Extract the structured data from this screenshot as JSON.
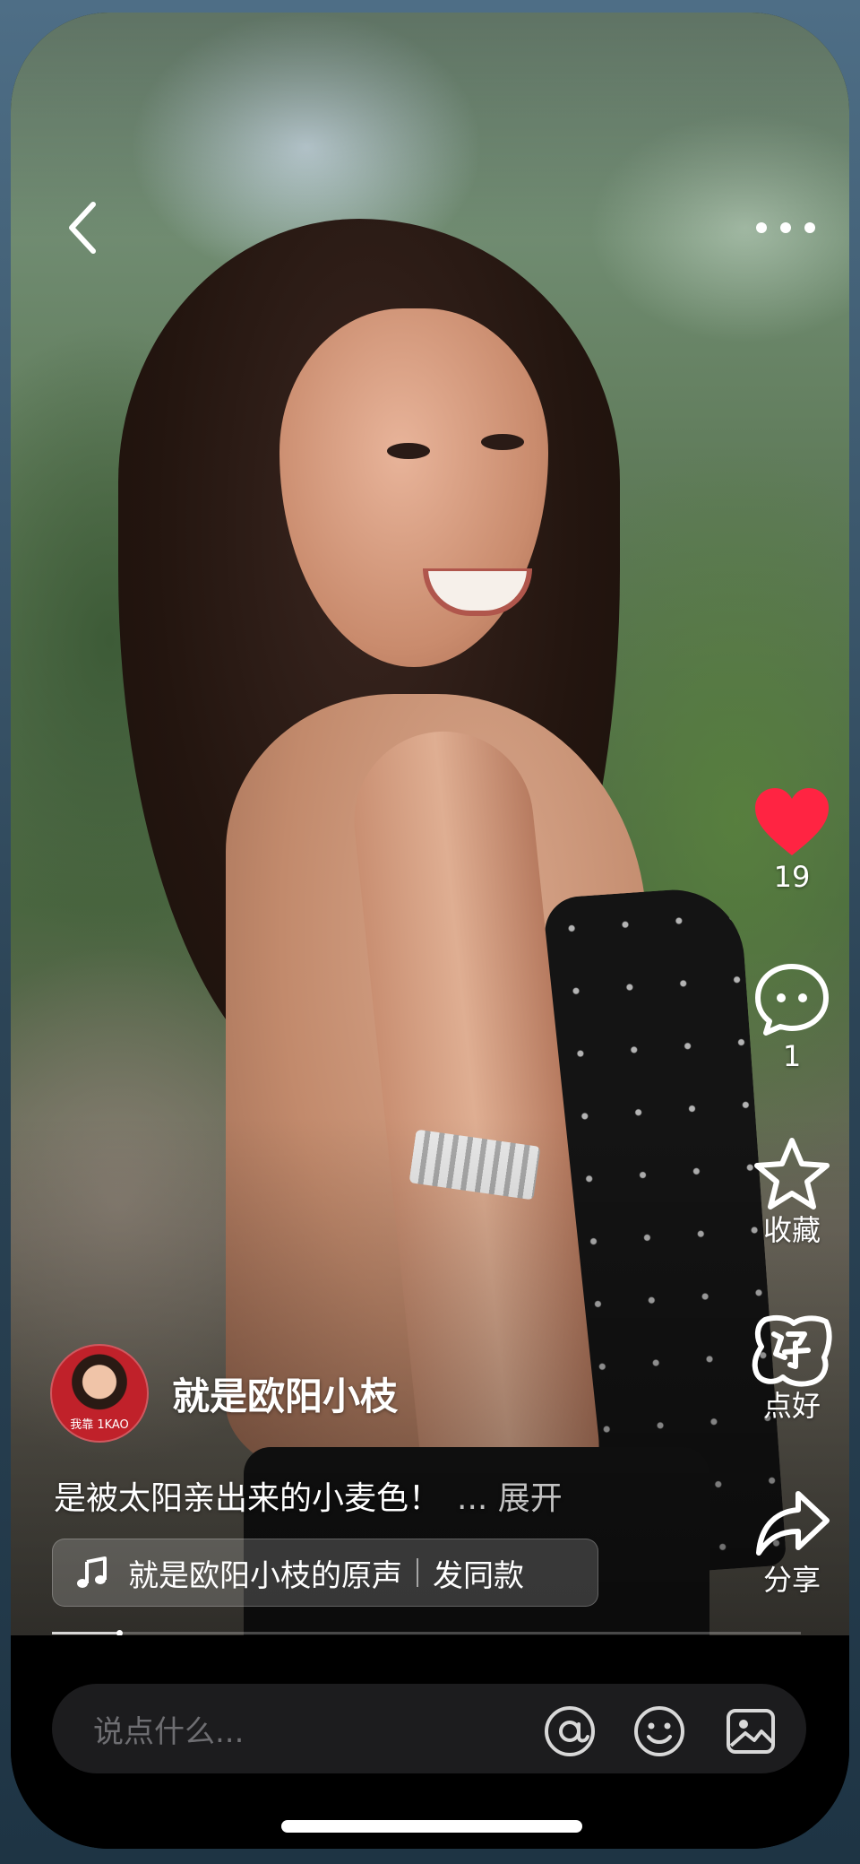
{
  "author": {
    "name": "就是欧阳小枝",
    "avatar_text": "我靠 1KAO"
  },
  "caption": {
    "text": "是被太阳亲出来的小麦色！",
    "expand_label": "... 展开"
  },
  "music": {
    "sound_name": "就是欧阳小枝的原声",
    "same_label": "发同款"
  },
  "actions": {
    "like_count": "19",
    "comment_count": "1",
    "favorite_label": "收藏",
    "good_label": "点好",
    "share_label": "分享"
  },
  "comment_bar": {
    "placeholder": "说点什么..."
  },
  "progress": {
    "fraction": 0.09
  },
  "colors": {
    "like_heart": "#ff2442",
    "bottom_bar": "#000000",
    "input_bg": "#1c1c1e"
  },
  "icons": [
    "back-icon",
    "more-icon",
    "heart-icon",
    "comment-icon",
    "star-icon",
    "good-icon",
    "share-icon",
    "music-note-icon",
    "at-icon",
    "emoji-icon",
    "image-icon"
  ]
}
